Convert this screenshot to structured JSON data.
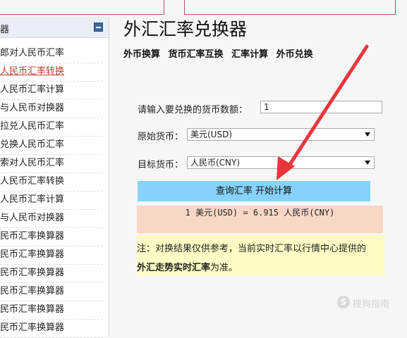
{
  "sidebar": {
    "title": "器",
    "items": [
      "郎对人民币汇率",
      "人民币汇率转换",
      "人民币汇率计算",
      "与人民币对换器",
      "拉兑人民币汇率",
      "兑换人民币汇率",
      "索对人民币汇率",
      "人民币汇率转换",
      "人民币汇率计算",
      "与人民币对换器",
      "民币汇率换算器",
      "民币汇率换算器",
      "民币汇率换算器",
      "民币汇率换算器",
      "民币汇率换算器",
      "民币汇率换算器"
    ],
    "active_index": 1
  },
  "main": {
    "title": "外汇汇率兑换器",
    "tabs": [
      "外币换算",
      "货币汇率互换",
      "汇率计算",
      "外币兑换"
    ],
    "form": {
      "amount_label": "请输入要兑换的货币数额：",
      "amount_value": "1",
      "from_label": "原始货币：",
      "from_value": "美元(USD)",
      "to_label": "目标货币：",
      "to_value": "人民币(CNY)",
      "submit_label": "查询汇率 开始计算"
    },
    "result": "1 美元(USD) = 6.915 人民币(CNY)",
    "note": {
      "line1": "注：对换结果仅供参考，当前实时汇率以行情中心提供的",
      "bold": "外汇走势实时汇率",
      "tail": "为准。"
    }
  },
  "watermark": {
    "symbol": "S",
    "text": "搜狗指南"
  },
  "colors": {
    "button": "#87d2fb",
    "result_bg": "#f9d7c7",
    "note_bg": "#fdfcc4",
    "arrow": "#e8363c",
    "active_link": "#c0392b"
  }
}
